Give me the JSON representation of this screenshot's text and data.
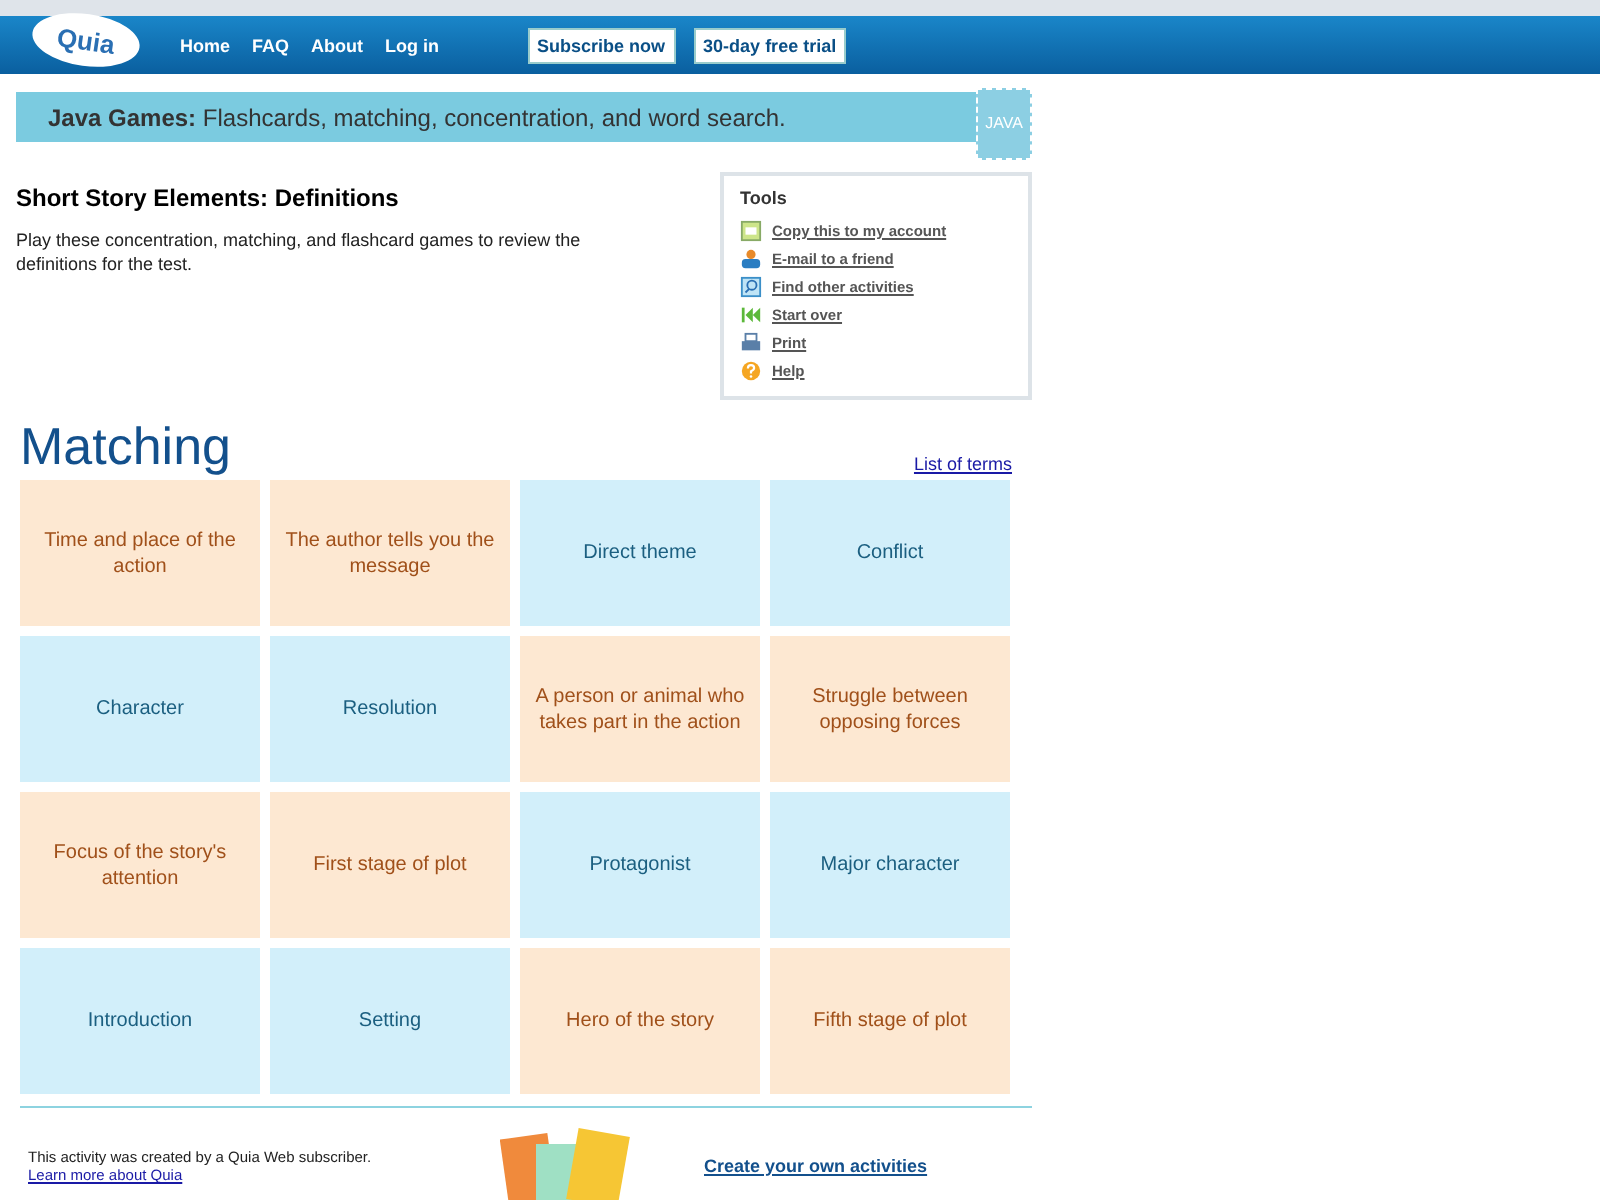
{
  "header": {
    "logo": "Quia",
    "nav": [
      "Home",
      "FAQ",
      "About",
      "Log in"
    ],
    "buttons": [
      "Subscribe now",
      "30-day free trial"
    ]
  },
  "banner": {
    "label": "Java Games:",
    "text": "Flashcards, matching, concentration, and word search.",
    "badge": "JAVA"
  },
  "activity": {
    "title": "Short Story Elements: Definitions",
    "description": "Play these concentration, matching, and flashcard games to review the definitions for the test."
  },
  "tools": {
    "title": "Tools",
    "items": [
      {
        "kind": "copy",
        "label": "Copy this to my account"
      },
      {
        "kind": "email",
        "label": "E-mail to a friend"
      },
      {
        "kind": "find",
        "label": "Find other activities"
      },
      {
        "kind": "restart",
        "label": "Start over"
      },
      {
        "kind": "print",
        "label": "Print"
      },
      {
        "kind": "help",
        "label": "Help"
      }
    ]
  },
  "game": {
    "title": "Matching",
    "link": "List of terms",
    "cards": [
      {
        "kind": "definition",
        "text": "Time and place of the action"
      },
      {
        "kind": "definition",
        "text": "The author tells you the message"
      },
      {
        "kind": "term",
        "text": "Direct theme"
      },
      {
        "kind": "term",
        "text": "Conflict"
      },
      {
        "kind": "term",
        "text": "Character"
      },
      {
        "kind": "term",
        "text": "Resolution"
      },
      {
        "kind": "definition",
        "text": "A person or animal who takes part in the action"
      },
      {
        "kind": "definition",
        "text": "Struggle between opposing forces"
      },
      {
        "kind": "definition",
        "text": "Focus of the story's attention"
      },
      {
        "kind": "definition",
        "text": "First stage of plot"
      },
      {
        "kind": "term",
        "text": "Protagonist"
      },
      {
        "kind": "term",
        "text": "Major character"
      },
      {
        "kind": "term",
        "text": "Introduction"
      },
      {
        "kind": "term",
        "text": "Setting"
      },
      {
        "kind": "definition",
        "text": "Hero of the story"
      },
      {
        "kind": "definition",
        "text": "Fifth stage of plot"
      }
    ]
  },
  "footer": {
    "note": "This activity was created by a Quia Web subscriber.",
    "learn_link": "Learn more about Quia",
    "create_link": "Create your own activities"
  }
}
